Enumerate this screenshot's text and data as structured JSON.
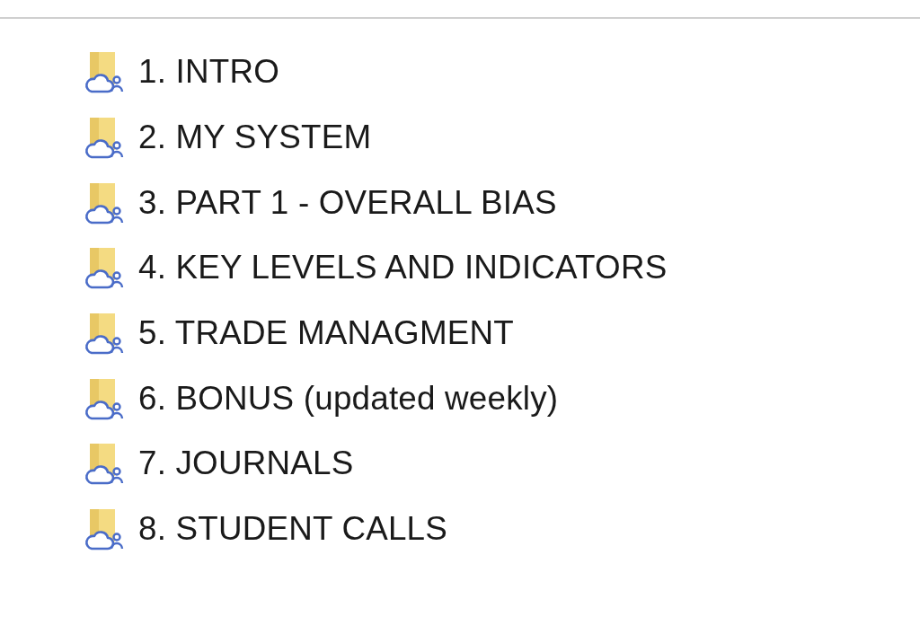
{
  "folders": [
    {
      "name": "1. INTRO"
    },
    {
      "name": "2. MY SYSTEM"
    },
    {
      "name": "3. PART 1 - OVERALL BIAS"
    },
    {
      "name": "4. KEY LEVELS AND INDICATORS"
    },
    {
      "name": "5. TRADE MANAGMENT"
    },
    {
      "name": "6. BONUS (updated weekly)"
    },
    {
      "name": "7. JOURNALS"
    },
    {
      "name": "8. STUDENT CALLS"
    }
  ]
}
